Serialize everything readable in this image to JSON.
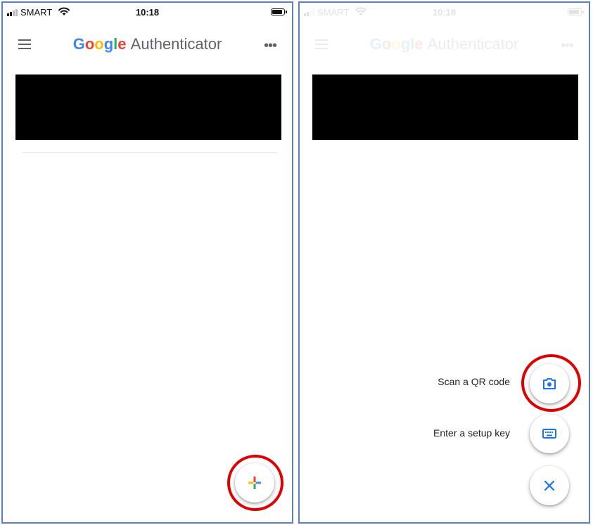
{
  "status_bar": {
    "carrier": "SMART",
    "time": "10:18"
  },
  "app_bar": {
    "title_brand": "Google",
    "title_name": "Authenticator"
  },
  "colors": {
    "google_blue": "#4285F4",
    "google_red": "#EA4335",
    "google_yellow": "#FBBC05",
    "google_green": "#34A853",
    "highlight_red": "#E00000"
  },
  "icons": {
    "menu": "menu-icon",
    "more": "more-horiz-icon",
    "add": "plus-icon",
    "camera": "camera-icon",
    "keyboard": "keyboard-icon",
    "close": "close-icon"
  },
  "fab_menu": {
    "scan_label": "Scan a QR code",
    "setup_key_label": "Enter a setup key"
  }
}
